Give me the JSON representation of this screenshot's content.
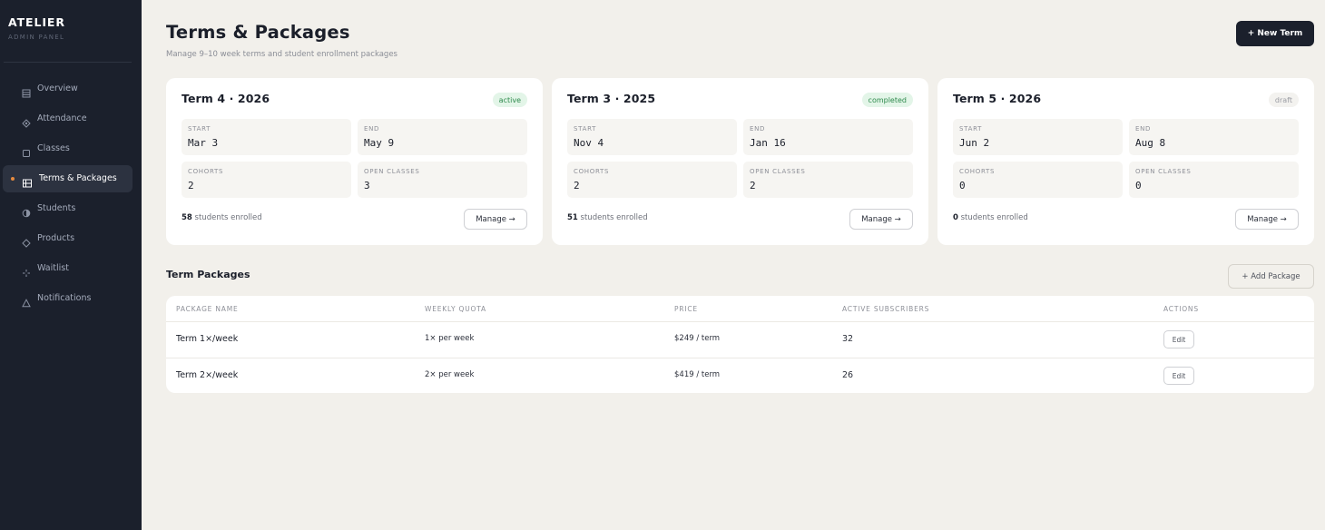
{
  "sidebar": {
    "brand": "ATELIER",
    "brand_sub": "ADMIN PANEL",
    "items": [
      {
        "label": "Overview",
        "icon": "grid-icon"
      },
      {
        "label": "Attendance",
        "icon": "diamond-check-icon"
      },
      {
        "label": "Classes",
        "icon": "square-icon"
      },
      {
        "label": "Terms & Packages",
        "icon": "layout-icon",
        "active": true
      },
      {
        "label": "Students",
        "icon": "half-circle-icon"
      },
      {
        "label": "Products",
        "icon": "diamond-icon"
      },
      {
        "label": "Waitlist",
        "icon": "sparkle-icon"
      },
      {
        "label": "Notifications",
        "icon": "triangle-icon"
      }
    ],
    "active_dot_color": "#e58a3f"
  },
  "header": {
    "title": "Terms & Packages",
    "subtitle": "Manage 9–10 week terms and student enrollment packages",
    "new_term_label": "+ New Term"
  },
  "terms": [
    {
      "name": "Term 4 · 2026",
      "status": "active",
      "start_label": "START",
      "start": "Mar 3",
      "end_label": "END",
      "end": "May 9",
      "cohorts_label": "COHORTS",
      "cohorts": "2",
      "open_label": "OPEN CLASSES",
      "open": "3",
      "enrolled_count": "58",
      "enrolled_text": "students enrolled",
      "manage_label": "Manage →"
    },
    {
      "name": "Term 3 · 2025",
      "status": "completed",
      "start_label": "START",
      "start": "Nov 4",
      "end_label": "END",
      "end": "Jan 16",
      "cohorts_label": "COHORTS",
      "cohorts": "2",
      "open_label": "OPEN CLASSES",
      "open": "2",
      "enrolled_count": "51",
      "enrolled_text": "students enrolled",
      "manage_label": "Manage →"
    },
    {
      "name": "Term 5 · 2026",
      "status": "draft",
      "start_label": "START",
      "start": "Jun 2",
      "end_label": "END",
      "end": "Aug 8",
      "cohorts_label": "COHORTS",
      "cohorts": "0",
      "open_label": "OPEN CLASSES",
      "open": "0",
      "enrolled_count": "0",
      "enrolled_text": "students enrolled",
      "manage_label": "Manage →"
    }
  ],
  "packages": {
    "title": "Term Packages",
    "add_label": "+ Add Package",
    "headers": [
      "PACKAGE NAME",
      "WEEKLY QUOTA",
      "PRICE",
      "ACTIVE SUBSCRIBERS",
      "ACTIONS"
    ],
    "rows": [
      {
        "name": "Term 1×/week",
        "quota": "1× per week",
        "price": "$249 / term",
        "subscribers": "32",
        "action": "Edit"
      },
      {
        "name": "Term 2×/week",
        "quota": "2× per week",
        "price": "$419 / term",
        "subscribers": "26",
        "action": "Edit"
      }
    ]
  }
}
